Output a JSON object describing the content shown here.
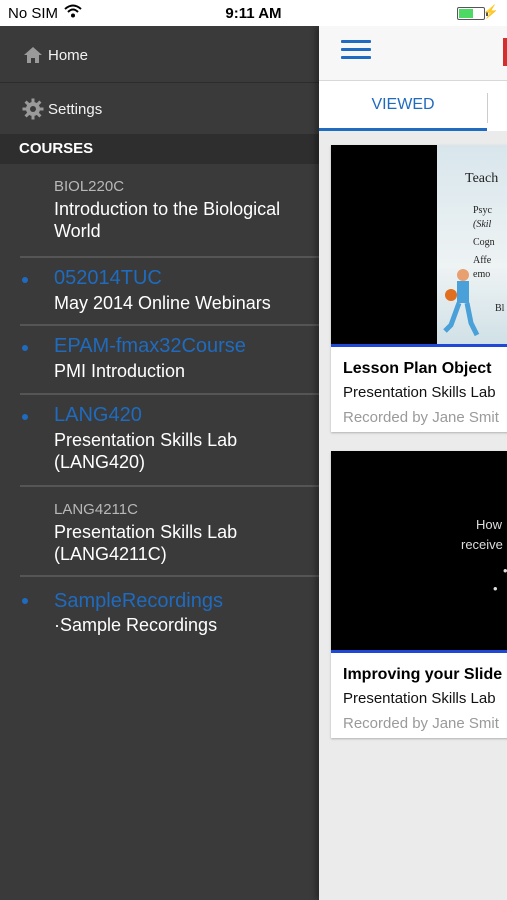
{
  "status_bar": {
    "carrier": "No SIM",
    "time": "9:11 AM"
  },
  "sidebar": {
    "home_label": "Home",
    "settings_label": "Settings",
    "courses_header": "COURSES",
    "courses": [
      {
        "code": "BIOL220C",
        "name": "Introduction to the Biological World",
        "highlighted": false
      },
      {
        "code": "052014TUC",
        "name": "May 2014 Online Webinars",
        "highlighted": true
      },
      {
        "code": "EPAM-fmax32Course",
        "name": "PMI Introduction",
        "highlighted": true
      },
      {
        "code": "LANG420",
        "name": "Presentation Skills Lab (LANG420)",
        "highlighted": true
      },
      {
        "code": "LANG4211C",
        "name": "Presentation Skills Lab (LANG4211C)",
        "highlighted": false
      },
      {
        "code": "SampleRecordings",
        "name": "·Sample Recordings",
        "highlighted": true
      }
    ]
  },
  "main": {
    "tabs": [
      {
        "label": "VIEWED",
        "active": true
      }
    ],
    "cards": [
      {
        "title": "Lesson Plan  Object",
        "course": "Presentation Skills Lab",
        "recorded_by": "Recorded by Jane Smit",
        "slide_title": "Teach",
        "slide_bullets": [
          "Psyc",
          "(Skil",
          "Cogn",
          "Affe",
          "emo",
          "Bl"
        ]
      },
      {
        "title": "Improving your Slide",
        "course": "Presentation Skills Lab",
        "recorded_by": "Recorded by Jane Smit",
        "slide_lines": [
          "How",
          "receive"
        ]
      }
    ]
  },
  "colors": {
    "accent": "#1f6bbf",
    "sidebar_bg": "#3a3a3a",
    "header_bg": "#2e2e2e"
  }
}
